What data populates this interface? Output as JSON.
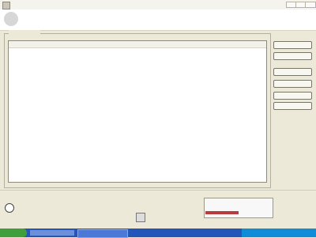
{
  "window": {
    "title": "",
    "min_label": "",
    "max_label": "",
    "close_label": ""
  },
  "header": {
    "title": "",
    "subtitle": "",
    "path": ""
  },
  "list_group": {
    "label": "",
    "columns": [
      "",
      "",
      ""
    ],
    "rows": [
      [
        "",
        "",
        ""
      ],
      [
        "",
        "",
        ""
      ],
      [
        "",
        "",
        ""
      ],
      [
        "",
        "",
        ""
      ],
      [
        "",
        "",
        ""
      ],
      [
        "",
        "",
        ""
      ],
      [
        "",
        "",
        ""
      ]
    ],
    "left_caption": "",
    "right_caption": ""
  },
  "buttons": [
    "",
    "",
    "",
    "",
    "",
    ""
  ],
  "status": {
    "label": "",
    "line1": "",
    "line2": ""
  },
  "progress": {
    "fraction": 0.5
  },
  "footer": {
    "left": "",
    "right": ""
  },
  "taskbar": {
    "start_label": "",
    "task_label": "",
    "tray_text": ""
  }
}
